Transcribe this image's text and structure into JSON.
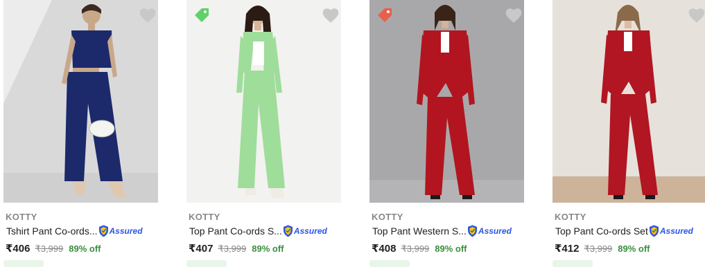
{
  "products": [
    {
      "brand": "KOTTY",
      "title": "Tshirt Pant Co-ords...",
      "assured_label": "Assured",
      "price": "₹406",
      "mrp": "₹3,999",
      "discount": "89% off",
      "image_bg": "#dcdcdc",
      "outfit_color": "#1c2a6b",
      "has_tag_icon": false
    },
    {
      "brand": "KOTTY",
      "title": "Top Pant Co-ords S...",
      "assured_label": "Assured",
      "price": "₹407",
      "mrp": "₹3,999",
      "discount": "89% off",
      "image_bg": "#f2f2f0",
      "outfit_color": "#9fdd9a",
      "has_tag_icon": true,
      "tag_color": "#5fd16a"
    },
    {
      "brand": "KOTTY",
      "title": "Top Pant Western S...",
      "assured_label": "Assured",
      "price": "₹408",
      "mrp": "₹3,999",
      "discount": "89% off",
      "image_bg": "#a8a8aa",
      "outfit_color": "#b2151f",
      "has_tag_icon": true,
      "tag_color": "#e8604c"
    },
    {
      "brand": "KOTTY",
      "title": "Top Pant Co-ords Set",
      "assured_label": "Assured",
      "price": "₹412",
      "mrp": "₹3,999",
      "discount": "89% off",
      "image_bg": "#e6e2db",
      "outfit_color": "#b11622",
      "has_tag_icon": false
    }
  ],
  "colors": {
    "brand_grey": "#878787",
    "assured_blue": "#2a55e5",
    "discount_green": "#388e3c",
    "heart_grey": "#c8c8c8"
  }
}
